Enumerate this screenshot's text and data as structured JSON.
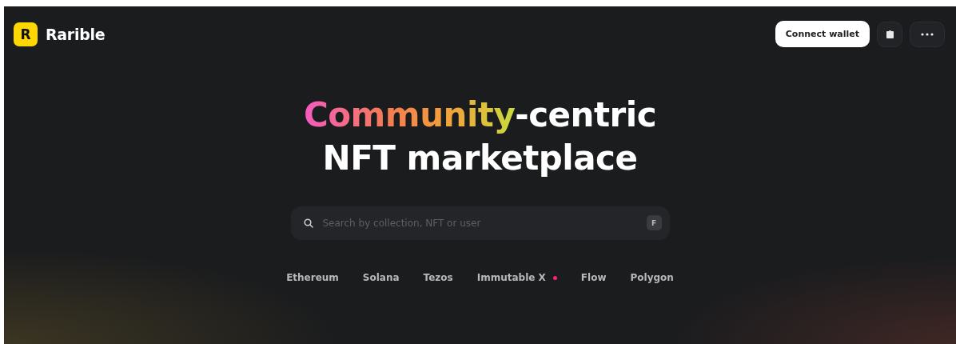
{
  "header": {
    "logo": {
      "mark": "R",
      "name": "Rarible"
    },
    "connect_button": "Connect wallet"
  },
  "headline": {
    "highlight": "Community",
    "rest": "-centric",
    "line2": "NFT marketplace"
  },
  "search": {
    "placeholder": "Search by collection, NFT or user",
    "shortcut": "F"
  },
  "chains": [
    {
      "label": "Ethereum",
      "dot": false
    },
    {
      "label": "Solana",
      "dot": false
    },
    {
      "label": "Tezos",
      "dot": false
    },
    {
      "label": "Immutable X",
      "dot": true
    },
    {
      "label": "Flow",
      "dot": false
    },
    {
      "label": "Polygon",
      "dot": false
    }
  ]
}
